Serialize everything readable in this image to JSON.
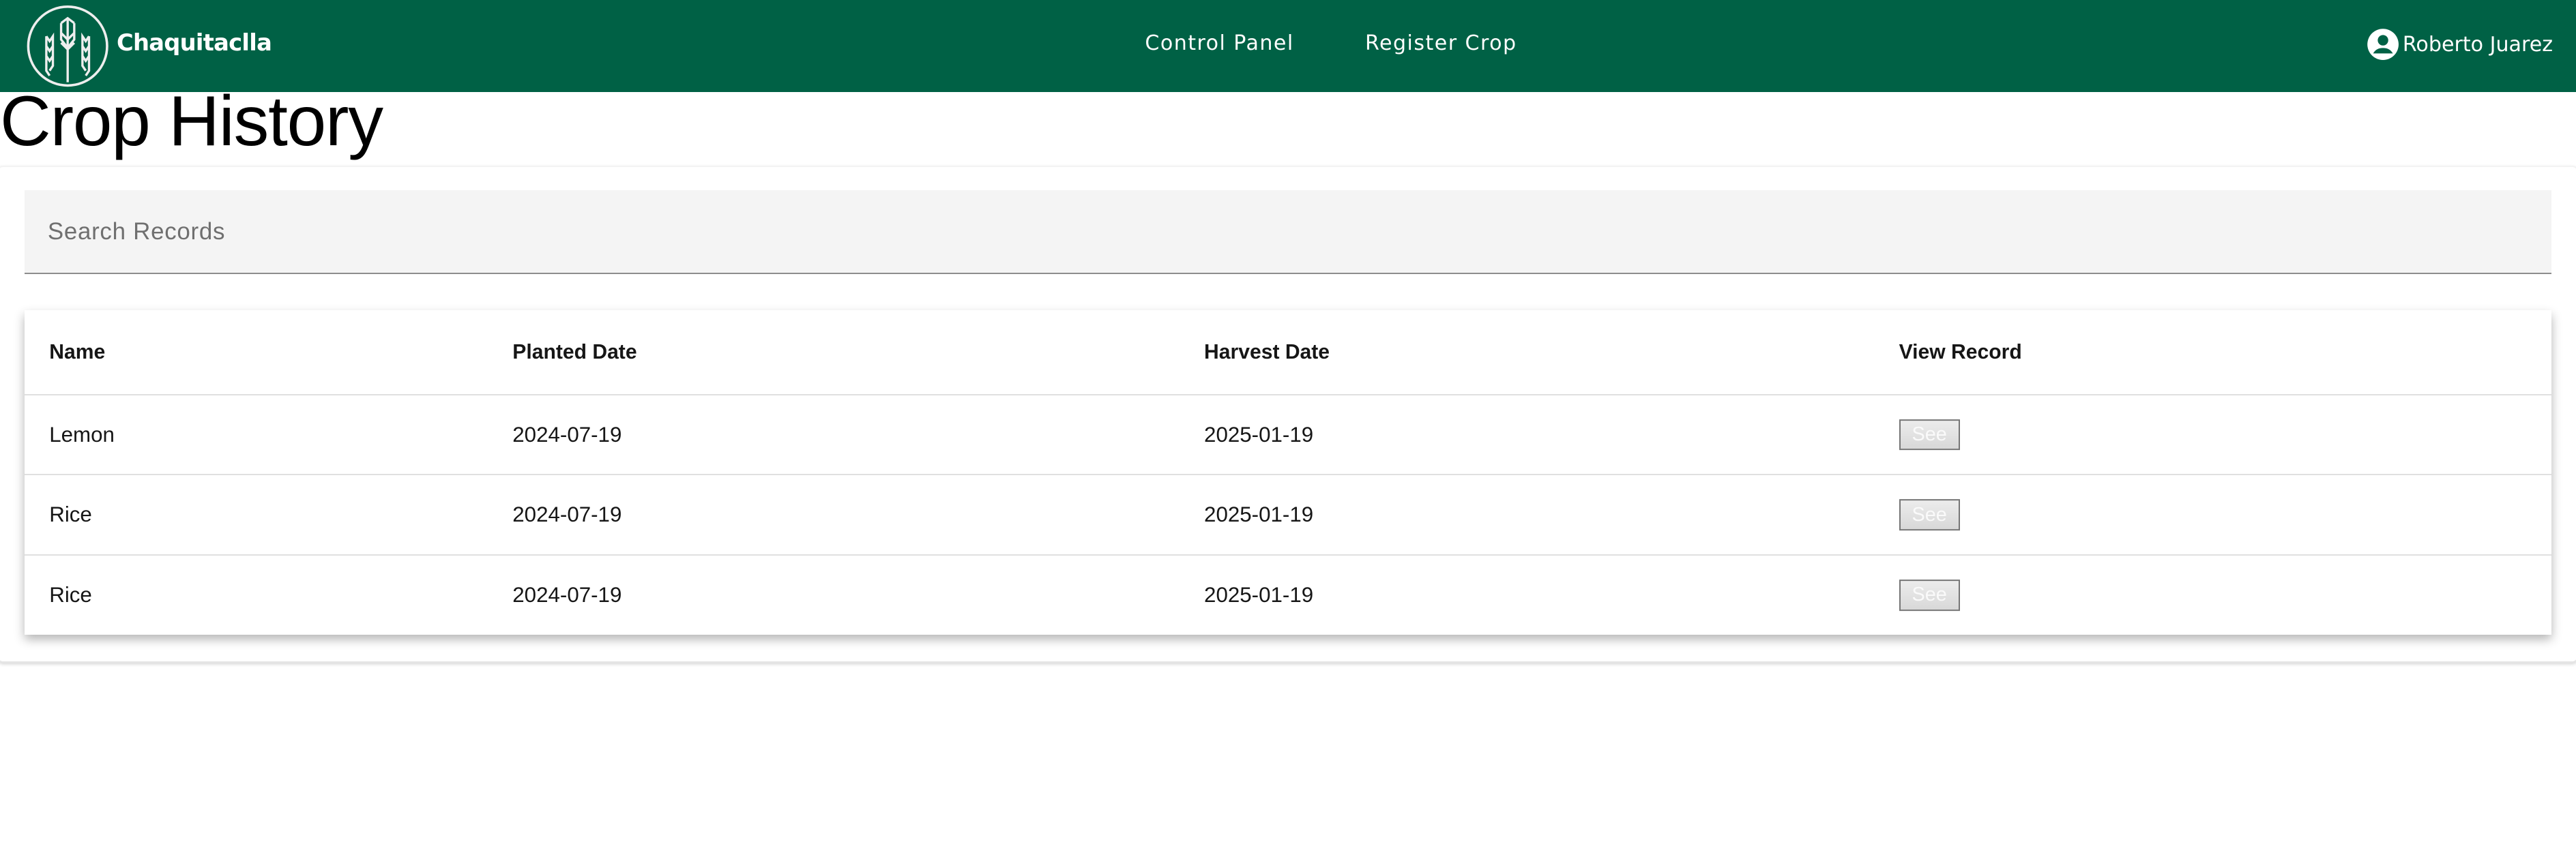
{
  "header": {
    "brand": "Chaquitaclla",
    "nav": [
      {
        "label": "Control Panel"
      },
      {
        "label": "Register Crop"
      }
    ],
    "user_name": "Roberto Juarez",
    "brand_color": "#006145"
  },
  "page": {
    "title": "Crop History"
  },
  "search": {
    "placeholder": "Search Records",
    "value": ""
  },
  "table": {
    "columns": [
      "Name",
      "Planted Date",
      "Harvest Date",
      "View Record"
    ],
    "rows": [
      {
        "name": "Lemon",
        "planted": "2024-07-19",
        "harvest": "2025-01-19",
        "action": "See"
      },
      {
        "name": "Rice",
        "planted": "2024-07-19",
        "harvest": "2025-01-19",
        "action": "See"
      },
      {
        "name": "Rice",
        "planted": "2024-07-19",
        "harvest": "2025-01-19",
        "action": "See"
      }
    ]
  }
}
